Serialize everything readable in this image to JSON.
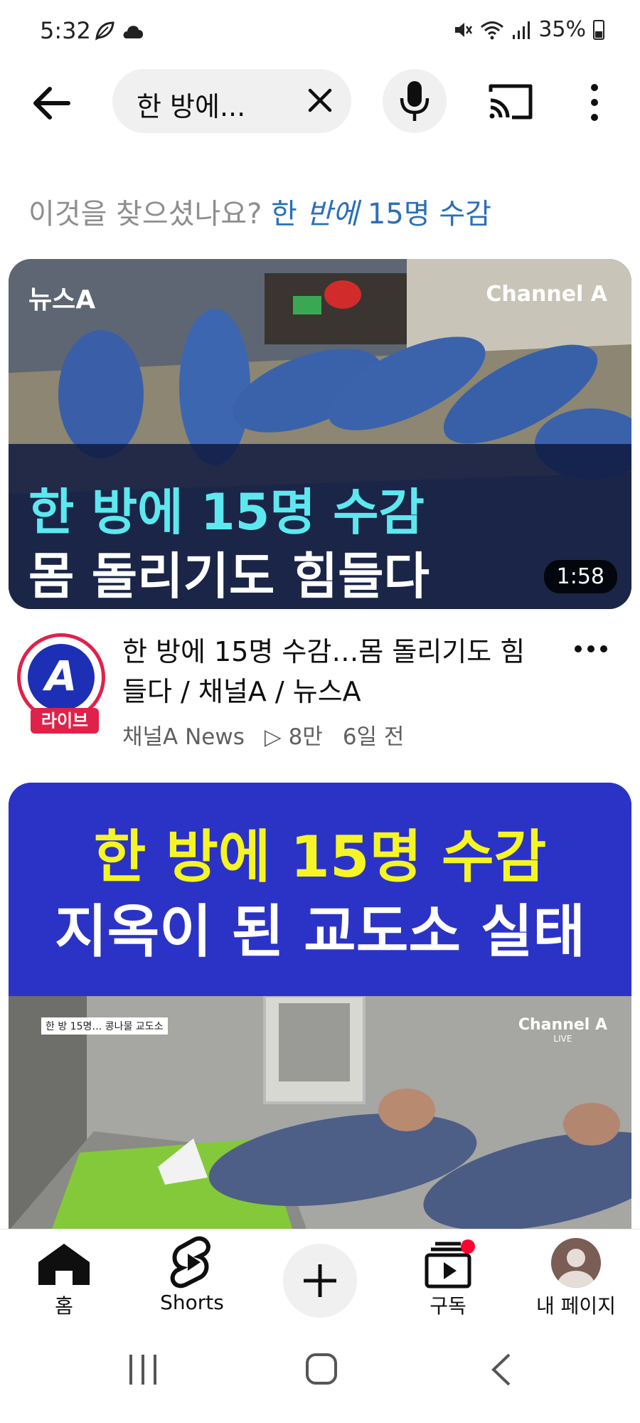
{
  "status_bar": {
    "time": "5:32",
    "battery": "35%",
    "left_icons": [
      "leaf-icon",
      "cloud-icon"
    ],
    "right_icons": [
      "mute-icon",
      "wifi-icon",
      "signal-icon",
      "battery-icon"
    ]
  },
  "search": {
    "query": "한 방에...",
    "back_icon": "back-arrow-icon",
    "clear_icon": "close-icon",
    "mic_icon": "mic-icon",
    "cast_icon": "cast-icon",
    "more_icon": "more-vertical-icon"
  },
  "suggestion": {
    "prefix": "이것을 찾으셨나요?",
    "link_before": "한 ",
    "link_emphasis": "반에",
    "link_after": " 15명 수감"
  },
  "videos": [
    {
      "thumb_logo_left": "뉴스A",
      "thumb_logo_right": "Channel A",
      "thumb_line1": "한 방에 15명 수감",
      "thumb_line2": "몸 돌리기도 힘들다",
      "duration": "1:58",
      "channel_avatar_letter": "A",
      "channel_live_badge": "라이브",
      "title": "한 방에 15명 수감…몸 돌리기도 힘들다 / 채널A / 뉴스A",
      "channel": "채널A News",
      "views": "▷ 8만",
      "age": "6일 전"
    },
    {
      "banner_line1": "한 방에 15명 수감",
      "banner_line2": "지옥이 된 교도소 실태",
      "scene_caption": "한 방 15명… 콩나물 교도소",
      "scene_logo": "Channel A",
      "scene_logo_sub": "LIVE"
    }
  ],
  "bottom_nav": {
    "items": [
      {
        "label": "홈",
        "icon": "home-icon"
      },
      {
        "label": "Shorts",
        "icon": "shorts-icon"
      },
      {
        "label": "",
        "icon": "plus-icon"
      },
      {
        "label": "구독",
        "icon": "subscriptions-icon"
      },
      {
        "label": "내 페이지",
        "icon": "avatar-icon"
      }
    ]
  },
  "colors": {
    "accent_link": "#2a6fb8",
    "thumb_highlight": "#5de8f0",
    "banner_yellow": "#f5f524",
    "banner_blue": "#2b33c6",
    "live_red": "#e0214a"
  }
}
